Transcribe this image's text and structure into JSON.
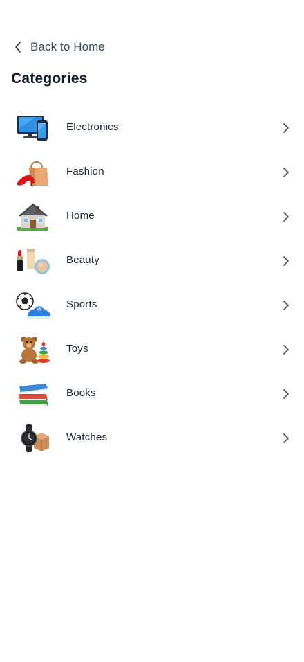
{
  "nav": {
    "back_label": "Back to Home"
  },
  "page": {
    "title": "Categories"
  },
  "categories": [
    {
      "label": "Electronics",
      "icon": "electronics-icon"
    },
    {
      "label": "Fashion",
      "icon": "fashion-icon"
    },
    {
      "label": "Home",
      "icon": "home-icon"
    },
    {
      "label": "Beauty",
      "icon": "beauty-icon"
    },
    {
      "label": "Sports",
      "icon": "sports-icon"
    },
    {
      "label": "Toys",
      "icon": "toys-icon"
    },
    {
      "label": "Books",
      "icon": "books-icon"
    },
    {
      "label": "Watches",
      "icon": "watches-icon"
    }
  ],
  "colors": {
    "title": "#111a2c",
    "text": "#1b2536",
    "muted": "#3a4656",
    "chevron": "#3a4656",
    "background": "#ffffff"
  }
}
